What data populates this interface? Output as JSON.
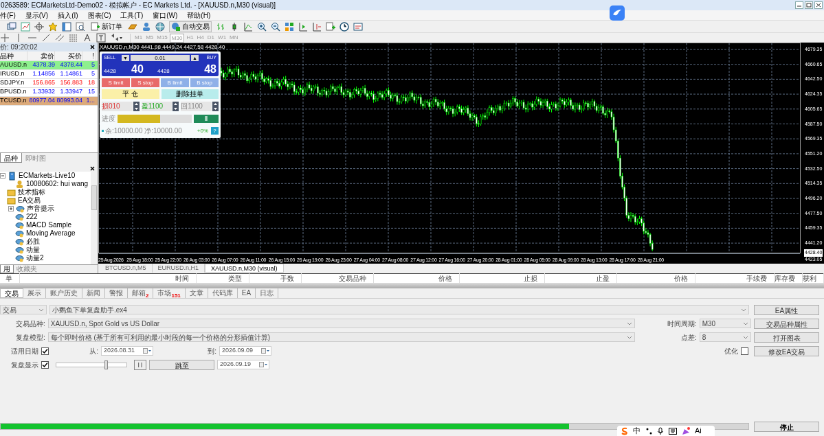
{
  "window": {
    "title": "0263589: ECMarketsLtd-Demo02 - 模拟帐户 - EC Markets Ltd. - [XAUUSD.n,M30 (visual)]"
  },
  "menu": [
    "件(F)",
    "显示(V)",
    "插入(I)",
    "图表(C)",
    "工具(T)",
    "窗口(W)",
    "帮助(H)"
  ],
  "toolbar": {
    "new_order": "新订单",
    "auto_trade": "自动交易"
  },
  "periods": [
    {
      "label": "M1",
      "selected": false
    },
    {
      "label": "M5",
      "selected": false
    },
    {
      "label": "M15",
      "selected": false
    },
    {
      "label": "M30",
      "selected": true
    },
    {
      "label": "H1",
      "selected": false
    },
    {
      "label": "H4",
      "selected": false
    },
    {
      "label": "D1",
      "selected": false
    },
    {
      "label": "W1",
      "selected": false
    },
    {
      "label": "MN",
      "selected": false
    }
  ],
  "market_watch": {
    "header": "价: 09:20:02",
    "columns": [
      "品种",
      "卖价",
      "买价",
      "!"
    ],
    "rows": [
      {
        "symbol": "AUUSD.n",
        "bid": "4378.39",
        "ask": "4378.44",
        "spread": "5",
        "kind": "up",
        "color": "#8ef08e"
      },
      {
        "symbol": "IRUSD.n",
        "bid": "1.14856",
        "ask": "1.14861",
        "spread": "5",
        "kind": "up"
      },
      {
        "symbol": "SDJPY.n",
        "bid": "156.865",
        "ask": "156.883",
        "spread": "18",
        "kind": "down"
      },
      {
        "symbol": "BPUSD.n",
        "bid": "1.33932",
        "ask": "1.33947",
        "spread": "15",
        "kind": "up"
      },
      {
        "symbol": "TCUSD.n",
        "bid": "80977.04",
        "ask": "80993.04",
        "spread": "1...",
        "kind": "up",
        "color": "#dcaa7a"
      }
    ],
    "tabs": [
      {
        "label": "品种",
        "selected": true
      },
      {
        "label": "即时图",
        "selected": false
      }
    ]
  },
  "navigator": {
    "items": [
      {
        "label": "ECMarkets-Live10",
        "kind": "server",
        "expanded": true,
        "children": [
          {
            "label": "10080602: hui wang",
            "kind": "account"
          }
        ]
      },
      {
        "label": "技术指标",
        "kind": "folder"
      },
      {
        "label": "EA交易",
        "kind": "folder",
        "children": [
          {
            "label": "声音提示",
            "kind": "ea",
            "expanded": false
          },
          {
            "label": "222",
            "kind": "ea"
          },
          {
            "label": "MACD Sample",
            "kind": "ea"
          },
          {
            "label": "Moving Average",
            "kind": "ea"
          },
          {
            "label": "必胜",
            "kind": "ea"
          },
          {
            "label": "动量",
            "kind": "ea"
          },
          {
            "label": "动量2",
            "kind": "ea"
          }
        ]
      }
    ],
    "tabs": [
      {
        "label": "用",
        "selected": true
      },
      {
        "label": "收藏夹",
        "selected": false
      }
    ]
  },
  "chart": {
    "header": "XAUUSD.n,M30  4441.98 4449.24 4427.58 4428.40",
    "price_labels": [
      "4679.35",
      "4660.65",
      "4642.50",
      "4624.35",
      "4605.65",
      "4587.50",
      "4569.35",
      "4551.20",
      "4532.50",
      "4514.35",
      "4496.20",
      "4477.50",
      "4459.35",
      "4441.20",
      "4423.05"
    ],
    "current_price": "4428.40",
    "time_labels": [
      "25 Aug 2026",
      "25 Aug 18:00",
      "25 Aug 22:00",
      "26 Aug 03:00",
      "26 Aug 07:00",
      "26 Aug 11:00",
      "26 Aug 15:00",
      "26 Aug 19:00",
      "26 Aug 23:00",
      "27 Aug 04:00",
      "27 Aug 08:00",
      "27 Aug 12:00",
      "27 Aug 16:00",
      "27 Aug 20:00",
      "28 Aug 01:00",
      "28 Aug 05:00",
      "28 Aug 09:00",
      "28 Aug 13:00",
      "28 Aug 17:00",
      "28 Aug 21:00"
    ],
    "trade_panel": {
      "sell": "SELL",
      "buy": "BUY",
      "down": "▼",
      "up": "▲",
      "lots": "0.01",
      "sell_base": "4428",
      "sell_pips": "40",
      "buy_base": "4428",
      "buy_pips": "48",
      "orders": [
        {
          "label": "S limit",
          "kind": "sell"
        },
        {
          "label": "S stop",
          "kind": "sell"
        },
        {
          "label": "B limit",
          "kind": "buy"
        },
        {
          "label": "B stop",
          "kind": "buy"
        }
      ],
      "close": "平 仓",
      "delete": "删除挂单",
      "steppers": [
        {
          "label": "损010",
          "kind": "loss"
        },
        {
          "label": "盈1100",
          "kind": "profit"
        },
        {
          "label": "回1100",
          "kind": "other"
        }
      ],
      "progress_label": "进度",
      "progress": {
        "level": 0.57
      },
      "pause": "‖",
      "balance": "余:10000.00 净:10000.00",
      "percent": "+0%",
      "help": "?"
    }
  },
  "chart_tabs": [
    {
      "label": "BTCUSD.n,M5",
      "selected": false
    },
    {
      "label": "EURUSD.n,H1",
      "selected": false
    },
    {
      "label": "XAUUSD.n,M30 (visual)",
      "selected": true
    }
  ],
  "terminal": {
    "columns": [
      "单",
      "时间",
      "类型",
      "手数",
      "交易品种",
      "价格",
      "止损",
      "止盈",
      "价格",
      "手续费",
      "库存费",
      "获利"
    ],
    "tabs": [
      {
        "label": "交易",
        "selected": true
      },
      {
        "label": "展示",
        "selected": false
      },
      {
        "label": "账户历史",
        "selected": false
      },
      {
        "label": "新闻",
        "selected": false
      },
      {
        "label": "警报",
        "selected": false
      },
      {
        "label": "邮箱",
        "badge": "2",
        "selected": false
      },
      {
        "label": "市场",
        "badge": "151",
        "selected": false
      },
      {
        "label": "文章",
        "selected": false
      },
      {
        "label": "代码库",
        "selected": false
      },
      {
        "label": "EA",
        "selected": false
      },
      {
        "label": "日志",
        "selected": false
      }
    ]
  },
  "tester": {
    "expert_type": "交易",
    "expert": "小鹦鱼下单复盘助手.ex4",
    "symbol_label": "交易品种:",
    "symbol": "XAUUSD.n, Spot Gold vs US Dollar",
    "period_label": "时间周期:",
    "period": "M30",
    "model_label": "复盘模型:",
    "model": "每个即时价格 (基于所有可利用的最小时段的每一个价格的分形插值计算)",
    "spread_label": "点差:",
    "spread": "8",
    "use_date_label": "适用日期",
    "use_date": true,
    "from_label": "从:",
    "from": "2026.08.31",
    "to_label": "到:",
    "to": "2026.09.09",
    "optimize_label": "优化",
    "optimize": false,
    "visual_label": "复盘显示",
    "visual": true,
    "speed": {
      "level": 0.72
    },
    "pause": "| |",
    "skip_button": "跳至",
    "skip_date": "2026.09.19",
    "buttons": [
      "EA属性",
      "交易品种属性",
      "打开图表",
      "修改EA交易"
    ],
    "progress": {
      "level": 0.76
    },
    "stop_button": "停止"
  },
  "ime_bar": {
    "lang": "中",
    "ai": "Ai"
  }
}
